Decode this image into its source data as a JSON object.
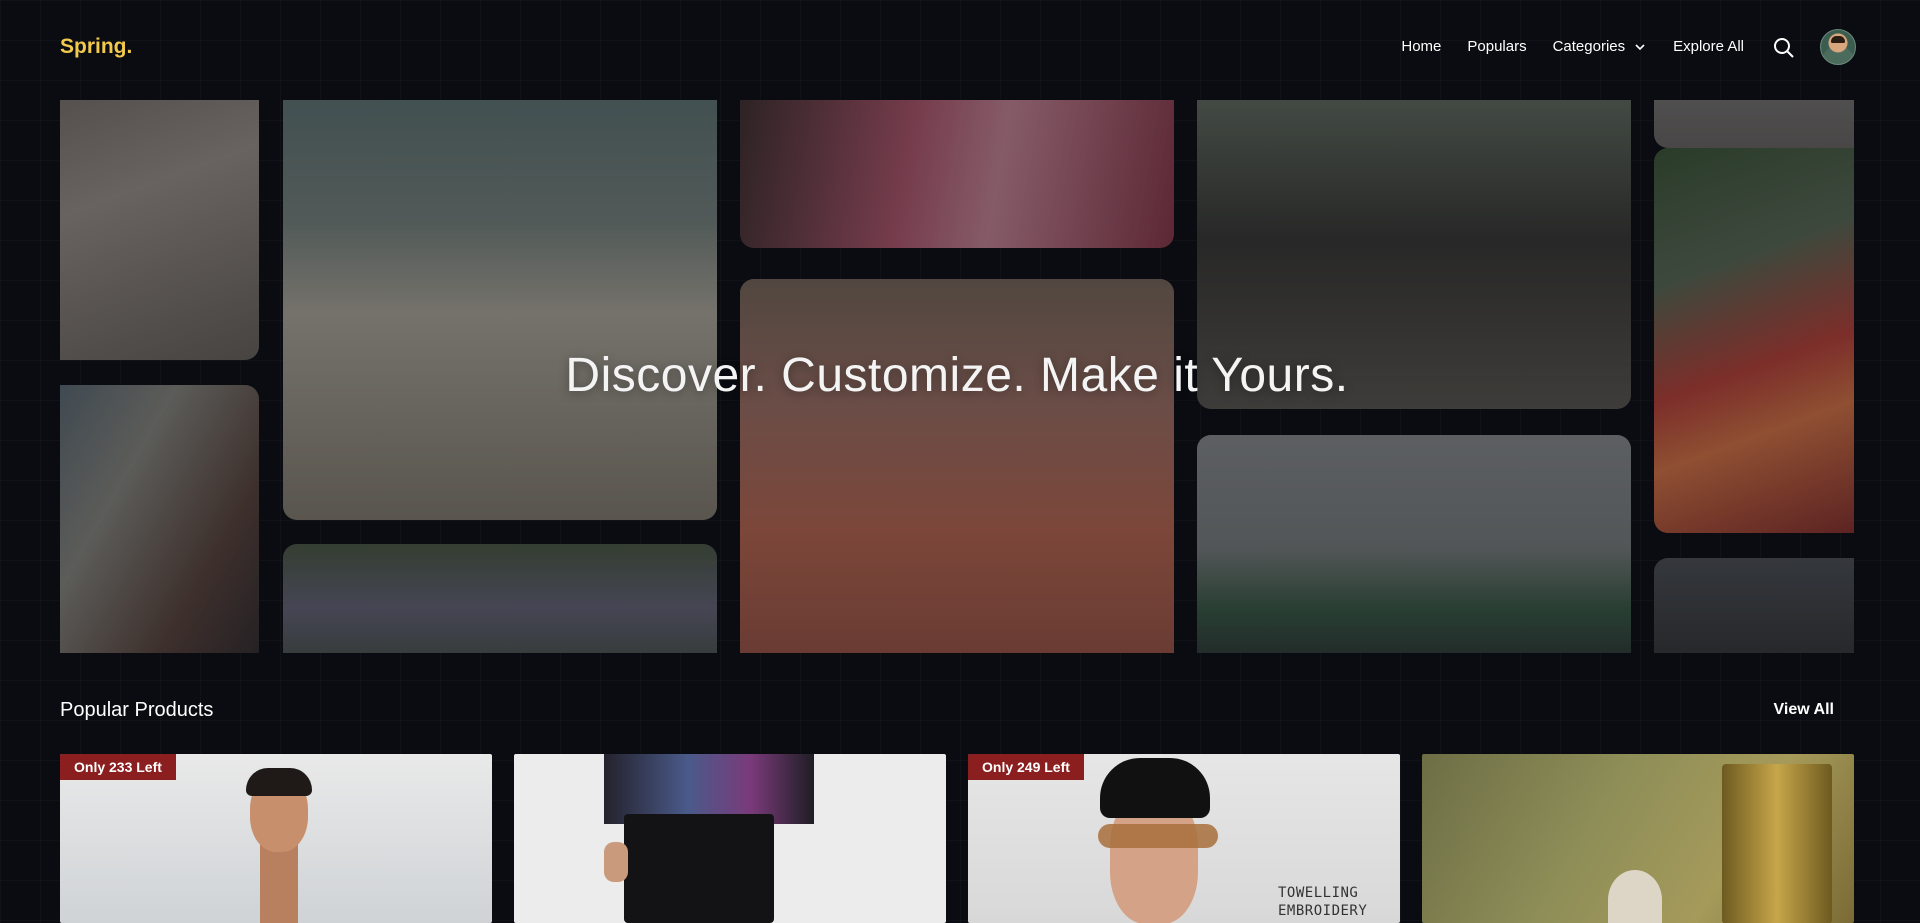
{
  "brand": {
    "logo": "Spring.",
    "accent": "#f2c94c"
  },
  "nav": {
    "items": [
      {
        "label": "Home"
      },
      {
        "label": "Populars"
      },
      {
        "label": "Categories"
      },
      {
        "label": "Explore All"
      }
    ]
  },
  "hero": {
    "title": "Discover. Customize. Make it Yours."
  },
  "section": {
    "title": "Popular Products",
    "view_all": "View All"
  },
  "products": [
    {
      "badge": "Only 233 Left"
    },
    {
      "badge": ""
    },
    {
      "badge": "Only 249 Left",
      "print_text_line1": "TOWELLING",
      "print_text_line2": "EMBROIDERY"
    },
    {
      "badge": ""
    }
  ],
  "colors": {
    "background": "#0a0c12",
    "badge": "#8b1e1e"
  }
}
